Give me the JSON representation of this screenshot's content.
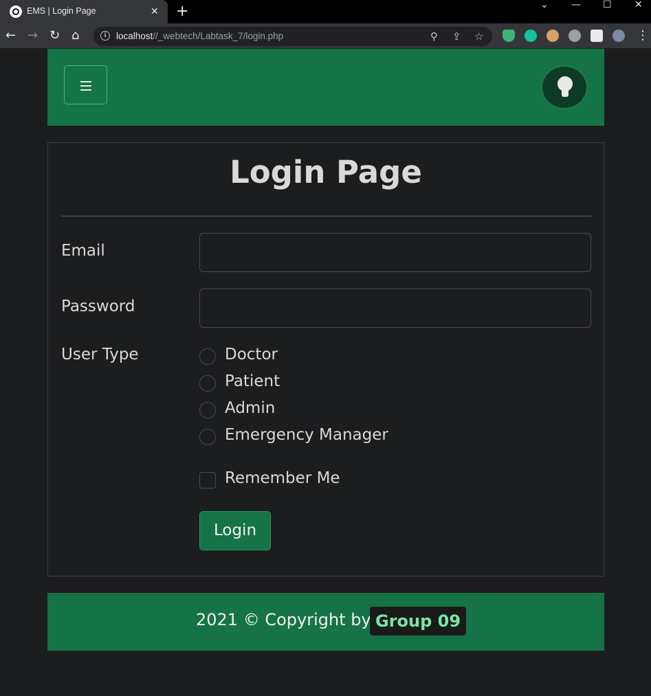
{
  "browser": {
    "tab_title": "EMS | Login Page",
    "tab_close": "✕",
    "new_tab": "+",
    "url_host": "localhost",
    "url_path": "//_webtech/Labtask_7/login.php",
    "window_controls": {
      "dropdown": "⌄",
      "minimize": "—",
      "maximize": "☐",
      "close": "✕"
    },
    "nav": {
      "back": "←",
      "forward": "→",
      "reload": "↻",
      "home": "⌂"
    },
    "omni_icons": {
      "zoom": "⚲",
      "share": "⇪",
      "bookmark": "☆"
    },
    "menu": "⋮",
    "extensions": [
      "shield-extension",
      "grammarly-extension",
      "avatar-extension",
      "bicycle-extension",
      "puzzle-extension",
      "profile-avatar"
    ]
  },
  "navbar": {
    "toggle_icon": "hamburger-menu-icon",
    "theme_icon": "lightbulb-icon",
    "color": "#157347"
  },
  "form": {
    "title": "Login Page",
    "email_label": "Email",
    "email_value": "",
    "password_label": "Password",
    "password_value": "",
    "user_type_label": "User Type",
    "user_types": [
      "Doctor",
      "Patient",
      "Admin",
      "Emergency Manager"
    ],
    "remember_label": "Remember Me",
    "login_label": "Login"
  },
  "footer": {
    "text": "2021 © Copyright by",
    "badge": "Group 09",
    "badge_color": "#75e6a6"
  }
}
